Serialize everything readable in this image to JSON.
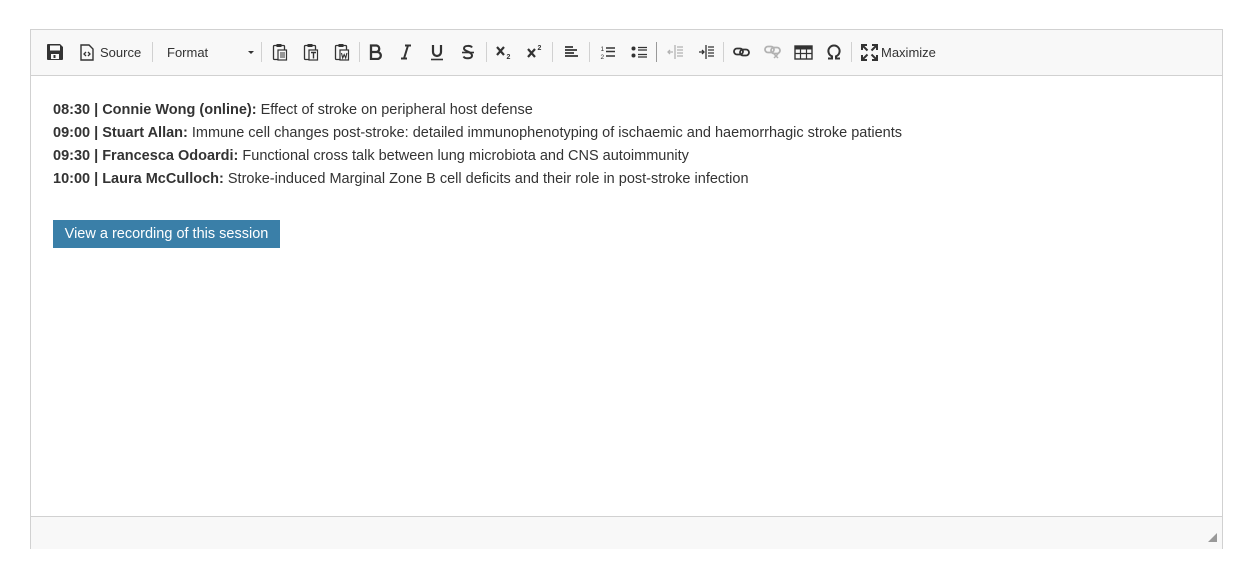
{
  "toolbar": {
    "save": {
      "icon": "save-icon"
    },
    "source": {
      "label": "Source",
      "icon": "source-icon"
    },
    "format": {
      "label": "Format",
      "icon": "chevron-down-icon"
    },
    "paste": {
      "icon": "paste-icon"
    },
    "paste_text": {
      "icon": "paste-text-icon"
    },
    "paste_word": {
      "icon": "paste-word-icon"
    },
    "bold": {
      "icon": "bold-icon"
    },
    "italic": {
      "icon": "italic-icon"
    },
    "underline": {
      "icon": "underline-icon"
    },
    "strike": {
      "icon": "strikethrough-icon"
    },
    "subscript": {
      "icon": "subscript-icon"
    },
    "superscript": {
      "icon": "superscript-icon"
    },
    "align_left": {
      "icon": "align-left-icon"
    },
    "numbered_list": {
      "icon": "numbered-list-icon"
    },
    "bulleted_list": {
      "icon": "bulleted-list-icon"
    },
    "outdent": {
      "icon": "outdent-icon",
      "disabled": true
    },
    "indent": {
      "icon": "indent-icon"
    },
    "link": {
      "icon": "link-icon"
    },
    "unlink": {
      "icon": "unlink-icon",
      "disabled": true
    },
    "table": {
      "icon": "table-icon"
    },
    "special_char": {
      "icon": "omega-icon"
    },
    "maximize": {
      "label": "Maximize",
      "icon": "maximize-icon"
    }
  },
  "content": {
    "items": [
      {
        "time": "08:30 | Connie Wong (online):",
        "text": " Effect of stroke on peripheral host defense"
      },
      {
        "time": "09:00 | Stuart Allan:",
        "text": " Immune cell changes post-stroke: detailed immunophenotyping of ischaemic and haemorrhagic stroke patients"
      },
      {
        "time": "09:30 | Francesca Odoardi:",
        "text": " Functional cross talk between lung microbiota and CNS autoimmunity"
      },
      {
        "time": "10:00 | Laura McCulloch:",
        "text": " Stroke-induced Marginal Zone B cell deficits and their role in post-stroke infection"
      }
    ],
    "recording_button": "View a recording of this session"
  },
  "colors": {
    "toolbar_bg": "#f8f8f8",
    "border": "#d1d1d1",
    "button_bg": "#3a7fa8",
    "text": "#333333"
  }
}
